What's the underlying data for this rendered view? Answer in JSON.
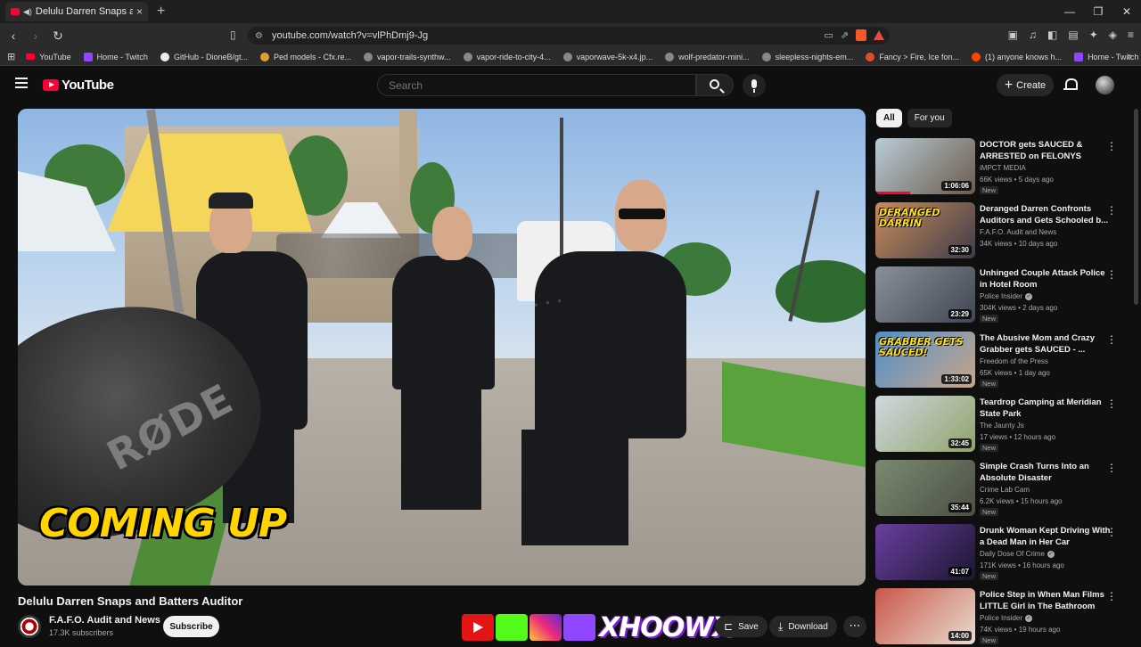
{
  "browser": {
    "tab_title": "Delulu Darren Snaps and Batt",
    "tab_close": "×",
    "new_tab": "+",
    "url": "youtube.com/watch?v=vlPhDmj9-Jg",
    "bookmarks": [
      {
        "label": "YouTube",
        "icon": "yt"
      },
      {
        "label": "Home - Twitch",
        "icon": "tw"
      },
      {
        "label": "GitHub - DioneB/gt...",
        "icon": "gh"
      },
      {
        "label": "Ped models - Cfx.re...",
        "icon": "cfx"
      },
      {
        "label": "vapor-trails-synthw...",
        "icon": "g"
      },
      {
        "label": "vapor-ride-to-city-4...",
        "icon": "g"
      },
      {
        "label": "vaporwave-5k-x4.jp...",
        "icon": "g"
      },
      {
        "label": "wolf-predator-mini...",
        "icon": "g"
      },
      {
        "label": "sleepless-nights-em...",
        "icon": "g"
      },
      {
        "label": "Fancy > Fire, Ice fon...",
        "icon": "ff"
      },
      {
        "label": "(1) anyone knows h...",
        "icon": "rd"
      },
      {
        "label": "Home - Twitch",
        "icon": "tw"
      }
    ]
  },
  "youtube": {
    "logo_text": "YouTube",
    "search_placeholder": "Search",
    "create_label": "Create"
  },
  "video": {
    "overlay_caption": "COMING UP",
    "mic_brand": "RØDE",
    "title": "Delulu Darren Snaps and Batters Auditor",
    "channel": "F.A.F.O. Audit and News",
    "subscribers": "17.3K subscribers",
    "subscribe_label": "Subscribe",
    "social_overlay_text": "XHOOWX",
    "save_label": "Save",
    "download_label": "Download",
    "more_label": "⋯"
  },
  "sidebar": {
    "chips": [
      {
        "label": "All",
        "selected": true
      },
      {
        "label": "For you",
        "selected": false
      }
    ],
    "items": [
      {
        "title": "DOCTOR gets SAUCED & ARRESTED on FELONYS",
        "channel": "iMPCT MEDIA",
        "verified": false,
        "meta": "66K views • 5 days ago",
        "badge": "New",
        "duration": "1:06:06",
        "progress": 0.35,
        "thumb": [
          "#b9ccd8",
          "#6b5b4b"
        ],
        "thumb_text": ""
      },
      {
        "title": "Deranged Darren Confronts Auditors and Gets Schooled b...",
        "channel": "F.A.F.O. Audit and News",
        "verified": false,
        "meta": "34K views • 10 days ago",
        "badge": "",
        "duration": "32:30",
        "progress": 0,
        "thumb": [
          "#c98b5a",
          "#3d3d4a"
        ],
        "thumb_text": "DERANGED DARRIN"
      },
      {
        "title": "Unhinged Couple Attack Police in Hotel Room",
        "channel": "Police Insider",
        "verified": true,
        "meta": "304K views • 2 days ago",
        "badge": "New",
        "duration": "23:29",
        "progress": 0,
        "thumb": [
          "#8a8f99",
          "#404652"
        ],
        "thumb_text": ""
      },
      {
        "title": "The Abusive Mom and Crazy Grabber gets SAUCED - ...",
        "channel": "Freedom of the Press",
        "verified": false,
        "meta": "65K views • 1 day ago",
        "badge": "New",
        "duration": "1:33:02",
        "progress": 0,
        "thumb": [
          "#4f8fc9",
          "#c9a58a"
        ],
        "thumb_text": "GRABBER GETS SAUCED!"
      },
      {
        "title": "Teardrop Camping at Meridian State Park",
        "channel": "The Jaunty Js",
        "verified": false,
        "meta": "17 views • 12 hours ago",
        "badge": "New",
        "duration": "32:45",
        "progress": 0,
        "thumb": [
          "#cfd8e0",
          "#8fa36a"
        ],
        "thumb_text": ""
      },
      {
        "title": "Simple Crash Turns Into an Absolute Disaster",
        "channel": "Crime Lab Cam",
        "verified": false,
        "meta": "6.2K views • 15 hours ago",
        "badge": "New",
        "duration": "35:44",
        "progress": 0,
        "thumb": [
          "#7b8a70",
          "#4a4f45"
        ],
        "thumb_text": ""
      },
      {
        "title": "Drunk Woman Kept Driving With a Dead Man in Her Car",
        "channel": "Daily Dose Of Crime",
        "verified": true,
        "meta": "171K views • 16 hours ago",
        "badge": "New",
        "duration": "41:07",
        "progress": 0,
        "thumb": [
          "#6a3fa0",
          "#1c1530"
        ],
        "thumb_text": ""
      },
      {
        "title": "Police Step in When Man Films LITTLE Girl in The Bathroom",
        "channel": "Police Insider",
        "verified": true,
        "meta": "74K views • 19 hours ago",
        "badge": "New",
        "duration": "14:00",
        "progress": 0,
        "thumb": [
          "#c9574a",
          "#e8dcd0"
        ],
        "thumb_text": ""
      }
    ]
  }
}
